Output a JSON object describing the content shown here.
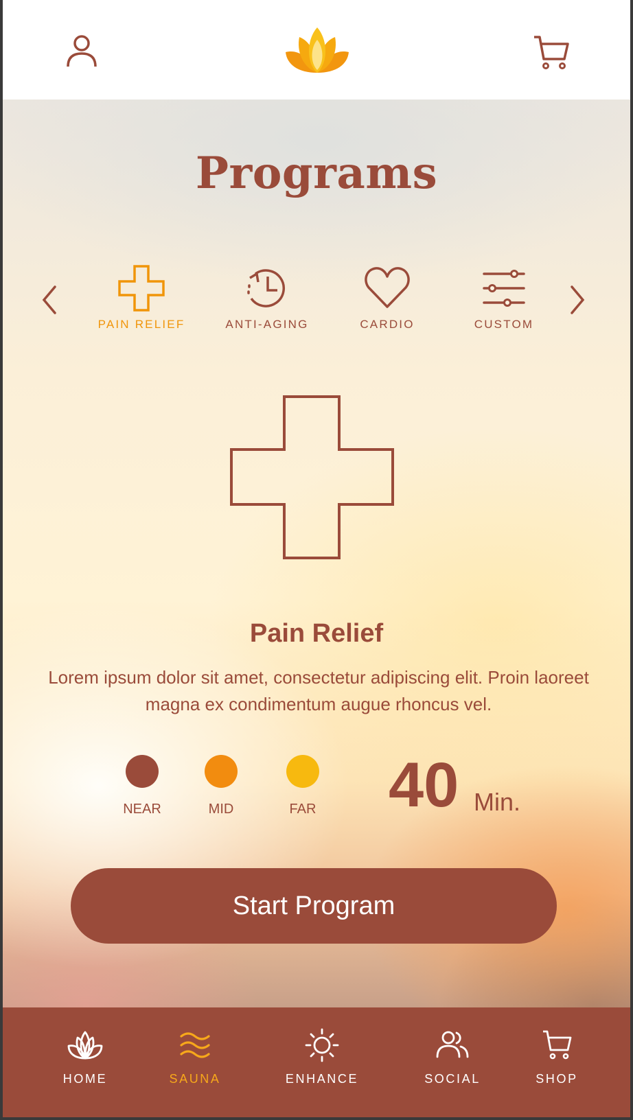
{
  "header": {
    "user_icon": "user-icon",
    "logo_icon": "lotus-logo",
    "cart_icon": "cart-icon"
  },
  "title": "Programs",
  "categories": [
    {
      "label": "PAIN RELIEF",
      "icon": "plus-cross-icon",
      "active": true
    },
    {
      "label": "ANTI-AGING",
      "icon": "clock-history-icon",
      "active": false
    },
    {
      "label": "CARDIO",
      "icon": "heart-icon",
      "active": false
    },
    {
      "label": "CUSTOM",
      "icon": "sliders-icon",
      "active": false
    }
  ],
  "program": {
    "name": "Pain Relief",
    "description": "Lorem ipsum dolor sit amet, consectetur adipiscing elit. Proin laoreet magna ex condimentum augue rhoncus vel.",
    "icon": "plus-cross-icon"
  },
  "zones": [
    {
      "label": "NEAR",
      "color": "#9a4b3a"
    },
    {
      "label": "MID",
      "color": "#f28c0f"
    },
    {
      "label": "FAR",
      "color": "#f7b90f"
    }
  ],
  "duration": {
    "value": "40",
    "unit": "Min."
  },
  "start_button": "Start Program",
  "nav": [
    {
      "label": "HOME",
      "icon": "lotus-icon",
      "active": false
    },
    {
      "label": "SAUNA",
      "icon": "heat-waves-icon",
      "active": true
    },
    {
      "label": "ENHANCE",
      "icon": "sun-icon",
      "active": false
    },
    {
      "label": "SOCIAL",
      "icon": "users-icon",
      "active": false
    },
    {
      "label": "SHOP",
      "icon": "cart-icon",
      "active": false
    }
  ],
  "colors": {
    "brand": "#9a4b3a",
    "accent": "#f0950a",
    "accent_light": "#f7b90f"
  }
}
